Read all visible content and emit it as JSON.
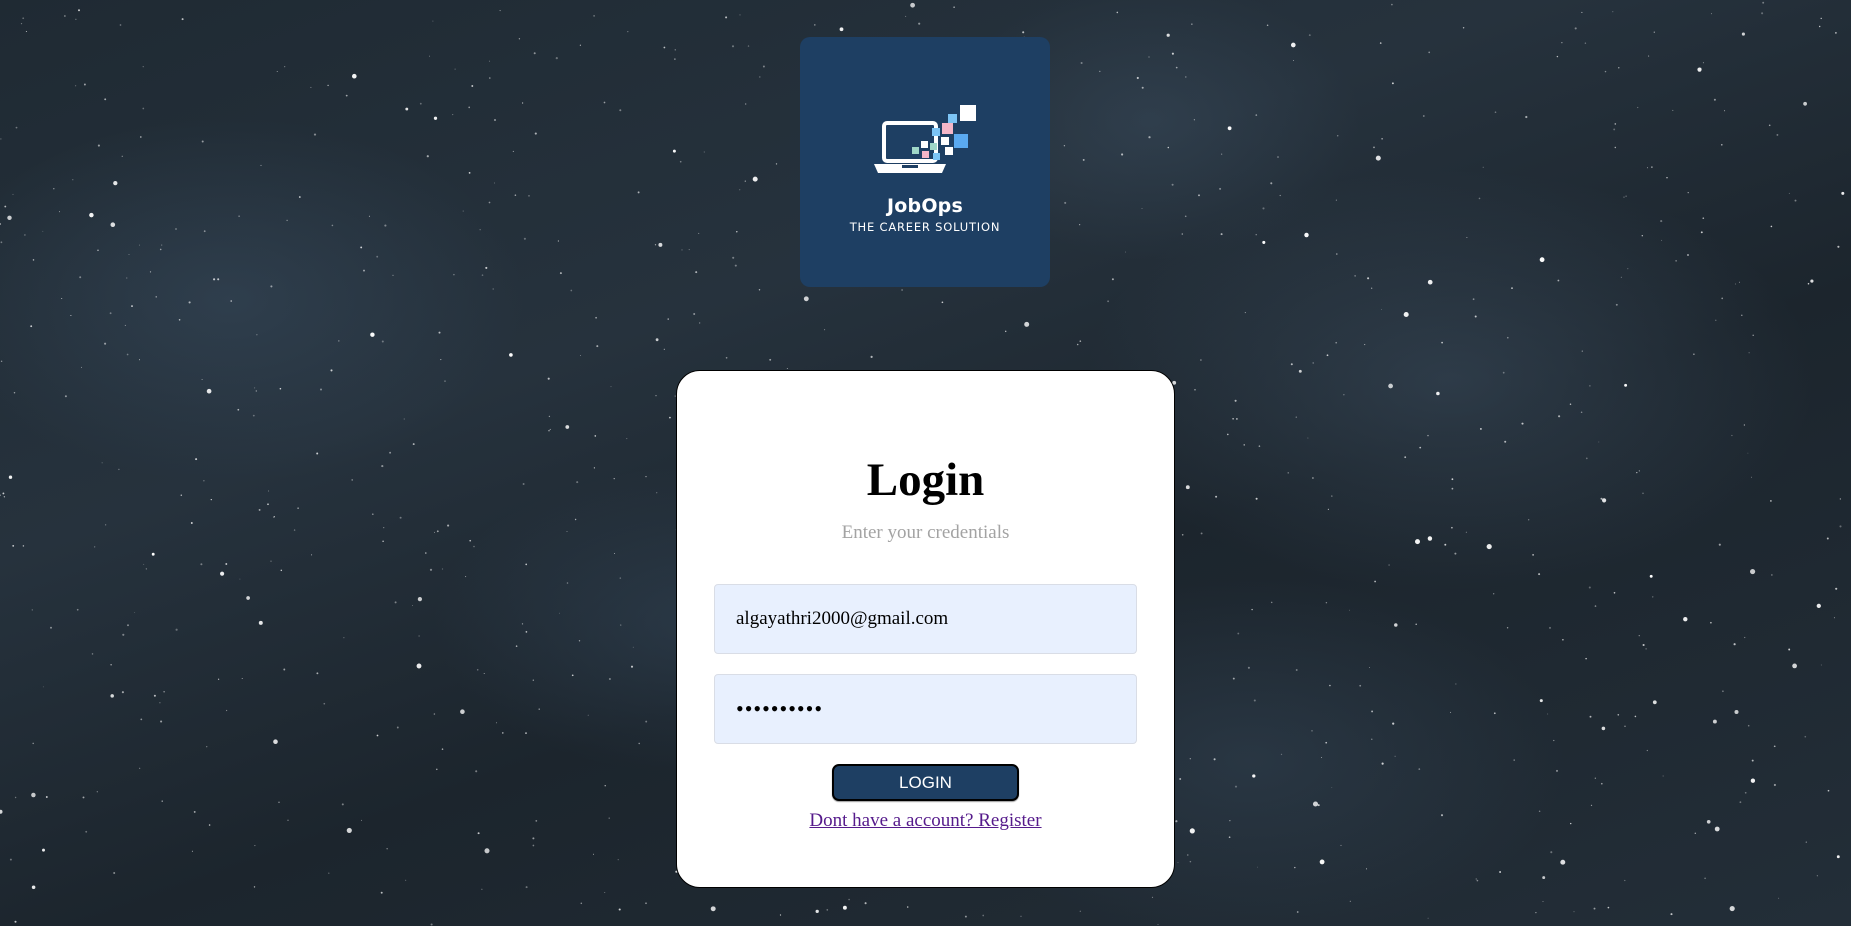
{
  "logo": {
    "name": "JobOps",
    "tagline": "THE CAREER SOLUTION",
    "icon": "laptop-pixels-icon"
  },
  "login": {
    "title": "Login",
    "subtitle": "Enter your credentials",
    "email_value": "algayathri2000@gmail.com",
    "password_value": "••••••••••",
    "button_label": "LOGIN",
    "register_link": "Dont have a account? Register"
  },
  "colors": {
    "brand": "#1e3f63",
    "input_background": "#e8f0fe",
    "link": "#551a8b",
    "subtitle": "#a3a3a3"
  }
}
